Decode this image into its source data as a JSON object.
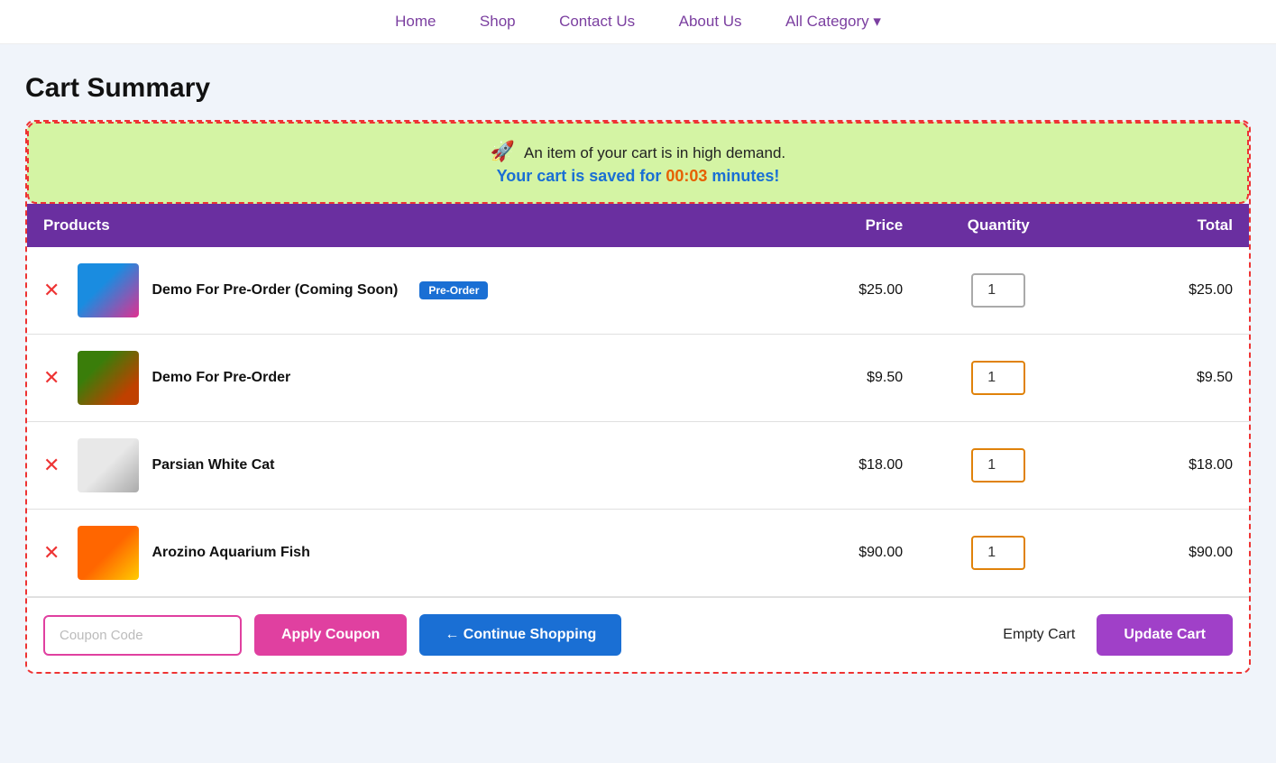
{
  "nav": {
    "links": [
      {
        "label": "Home",
        "href": "#"
      },
      {
        "label": "Shop",
        "href": "#"
      },
      {
        "label": "Contact Us",
        "href": "#"
      },
      {
        "label": "About Us",
        "href": "#"
      },
      {
        "label": "All Category ▾",
        "href": "#"
      }
    ]
  },
  "page": {
    "title": "Cart Summary"
  },
  "alert": {
    "line1": "An item of your cart is in high demand.",
    "line2_prefix": "Your cart is saved for ",
    "timer": "00:03",
    "line2_suffix": " minutes!"
  },
  "table": {
    "headers": {
      "products": "Products",
      "price": "Price",
      "quantity": "Quantity",
      "total": "Total"
    },
    "rows": [
      {
        "id": "row-1",
        "name": "Demo For Pre-Order (Coming Soon)",
        "badge": "Pre-Order",
        "price": "$25.00",
        "qty": "1",
        "total": "$25.00",
        "thumb_class": "thumb-bird",
        "qty_border": "gray"
      },
      {
        "id": "row-2",
        "name": "Demo For Pre-Order",
        "badge": null,
        "price": "$9.50",
        "qty": "1",
        "total": "$9.50",
        "thumb_class": "thumb-robin",
        "qty_border": "orange"
      },
      {
        "id": "row-3",
        "name": "Parsian White Cat",
        "badge": null,
        "price": "$18.00",
        "qty": "1",
        "total": "$18.00",
        "thumb_class": "thumb-cat",
        "qty_border": "orange"
      },
      {
        "id": "row-4",
        "name": "Arozino Aquarium Fish",
        "badge": null,
        "price": "$90.00",
        "qty": "1",
        "total": "$90.00",
        "thumb_class": "thumb-fish",
        "qty_border": "orange"
      }
    ]
  },
  "bottom": {
    "coupon_placeholder": "Coupon Code",
    "apply_coupon_label": "Apply Coupon",
    "continue_shopping_label": "← Continue Shopping",
    "empty_cart_label": "Empty Cart",
    "update_cart_label": "Update Cart"
  }
}
